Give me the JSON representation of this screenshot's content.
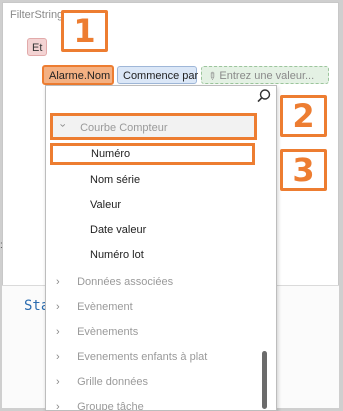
{
  "filter": {
    "title": "FilterString",
    "operator_chip": "Et",
    "field_chip": "Alarme.Nom",
    "condition_chip": "Commence par",
    "value_placeholder": "Entrez une valeur..."
  },
  "callouts": [
    "1",
    "2",
    "3"
  ],
  "background_code": "Sta",
  "dropdown": {
    "search_value": "",
    "group": {
      "label": "Courbe Compteur",
      "expanded": true
    },
    "children": [
      "Numéro",
      "Nom série",
      "Valeur",
      "Date valeur",
      "Numéro lot"
    ],
    "collapsed_items": [
      "Données associées",
      "Evènement",
      "Evènements",
      "Evenements enfants à plat",
      "Grille données",
      "Groupe tâche"
    ]
  },
  "colors": {
    "highlight": "#ed7d31",
    "field_chip_bg": "#f4b183",
    "condition_chip_bg": "#dbe7f7",
    "value_chip_bg": "#e4f1e4",
    "operator_chip_bg": "#f3d3d3"
  }
}
